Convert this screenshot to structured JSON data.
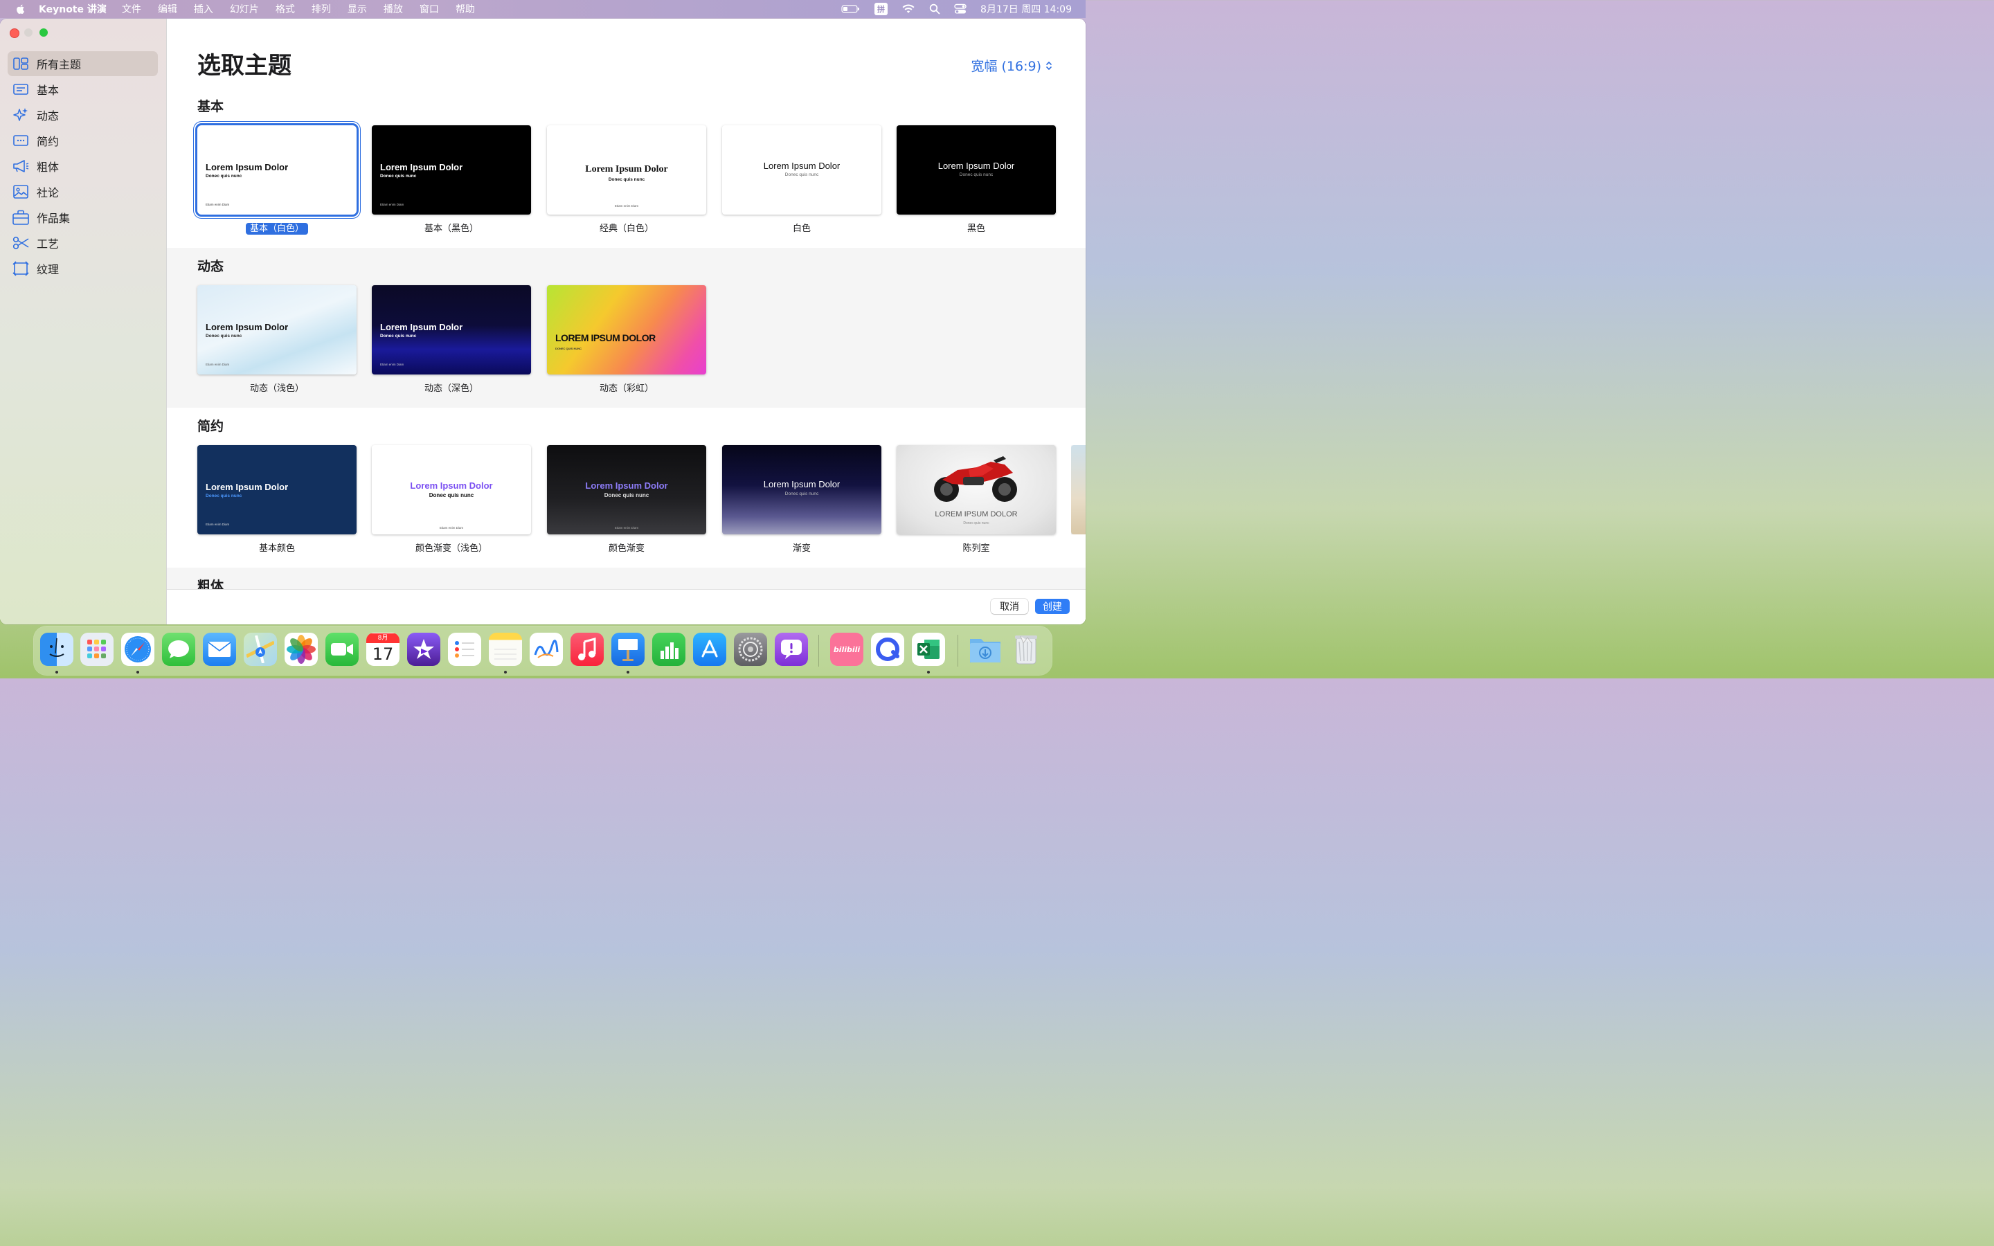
{
  "menubar": {
    "app_name": "Keynote 讲演",
    "items": [
      "文件",
      "编辑",
      "插入",
      "幻灯片",
      "格式",
      "排列",
      "显示",
      "播放",
      "窗口",
      "帮助"
    ],
    "ime": "拼",
    "clock": "8月17日 周四  14:09"
  },
  "sidebar": {
    "items": [
      {
        "label": "所有主题",
        "icon": "grid-icon"
      },
      {
        "label": "基本",
        "icon": "text-box-icon"
      },
      {
        "label": "动态",
        "icon": "sparkles-icon"
      },
      {
        "label": "简约",
        "icon": "dots-box-icon"
      },
      {
        "label": "粗体",
        "icon": "megaphone-icon"
      },
      {
        "label": "社论",
        "icon": "photo-icon"
      },
      {
        "label": "作品集",
        "icon": "briefcase-icon"
      },
      {
        "label": "工艺",
        "icon": "scissors-icon"
      },
      {
        "label": "纹理",
        "icon": "texture-icon"
      }
    ]
  },
  "main": {
    "title": "选取主题",
    "size_select": "宽幅 (16:9)",
    "sections": [
      {
        "title": "基本",
        "themes": [
          {
            "label": "基本（白色）",
            "t1": "Lorem Ipsum Dolor",
            "t2": "Donec quis nunc",
            "t3": "Etiam enim Diam"
          },
          {
            "label": "基本（黑色）",
            "t1": "Lorem Ipsum Dolor",
            "t2": "Donec quis nunc",
            "t3": "Etiam enim Diam"
          },
          {
            "label": "经典（白色）",
            "t1": "Lorem Ipsum Dolor",
            "t2": "Donec quis nunc",
            "t3": "Etiam enim Diam"
          },
          {
            "label": "白色",
            "t1": "Lorem Ipsum Dolor",
            "t2": "Donec quis nunc"
          },
          {
            "label": "黑色",
            "t1": "Lorem Ipsum Dolor",
            "t2": "Donec quis nunc"
          }
        ]
      },
      {
        "title": "动态",
        "themes": [
          {
            "label": "动态（浅色）",
            "t1": "Lorem Ipsum Dolor",
            "t2": "Donec quis nunc",
            "t3": "Etiam enim Diam"
          },
          {
            "label": "动态（深色）",
            "t1": "Lorem Ipsum Dolor",
            "t2": "Donec quis nunc",
            "t3": "Etiam enim Diam"
          },
          {
            "label": "动态（彩虹）",
            "t1": "LOREM IPSUM DOLOR",
            "t2": "DONEC QUIS NUNC"
          }
        ]
      },
      {
        "title": "简约",
        "themes": [
          {
            "label": "基本颜色",
            "t1": "Lorem Ipsum Dolor",
            "t2": "Donec quis nunc",
            "t3": "Etiam enim Diam"
          },
          {
            "label": "颜色渐变（浅色）",
            "t1": "Lorem Ipsum Dolor",
            "t2": "Donec quis nunc",
            "t3": "Etiam enim Diam"
          },
          {
            "label": "颜色渐变",
            "t1": "Lorem Ipsum Dolor",
            "t2": "Donec quis nunc",
            "t3": "Etiam enim Diam"
          },
          {
            "label": "渐变",
            "t1": "Lorem Ipsum Dolor",
            "t2": "Donec quis nunc"
          },
          {
            "label": "陈列室",
            "t1": "LOREM IPSUM DOLOR",
            "t2": "Donec quis nunc"
          }
        ]
      },
      {
        "title": "粗体"
      }
    ]
  },
  "footer": {
    "cancel": "取消",
    "create": "创建"
  },
  "dock": {
    "apps": [
      "finder-icon",
      "launchpad-icon",
      "safari-icon",
      "messages-icon",
      "mail-icon",
      "maps-icon",
      "photos-icon",
      "facetime-icon",
      "calendar-icon",
      "imovie-icon",
      "reminders-icon",
      "notes-icon",
      "freeform-icon",
      "music-icon",
      "keynote-icon",
      "numbers-icon",
      "app-store-icon",
      "system-settings-icon",
      "feedback-icon",
      "bilibili-icon",
      "browser-icon",
      "excel-icon",
      "downloads-icon",
      "trash-icon"
    ],
    "calendar_month": "8月",
    "calendar_day": "17",
    "bilibili": "bilibili"
  },
  "colors": {
    "accent": "#2f6fe0",
    "create_button": "#2f7df6"
  }
}
